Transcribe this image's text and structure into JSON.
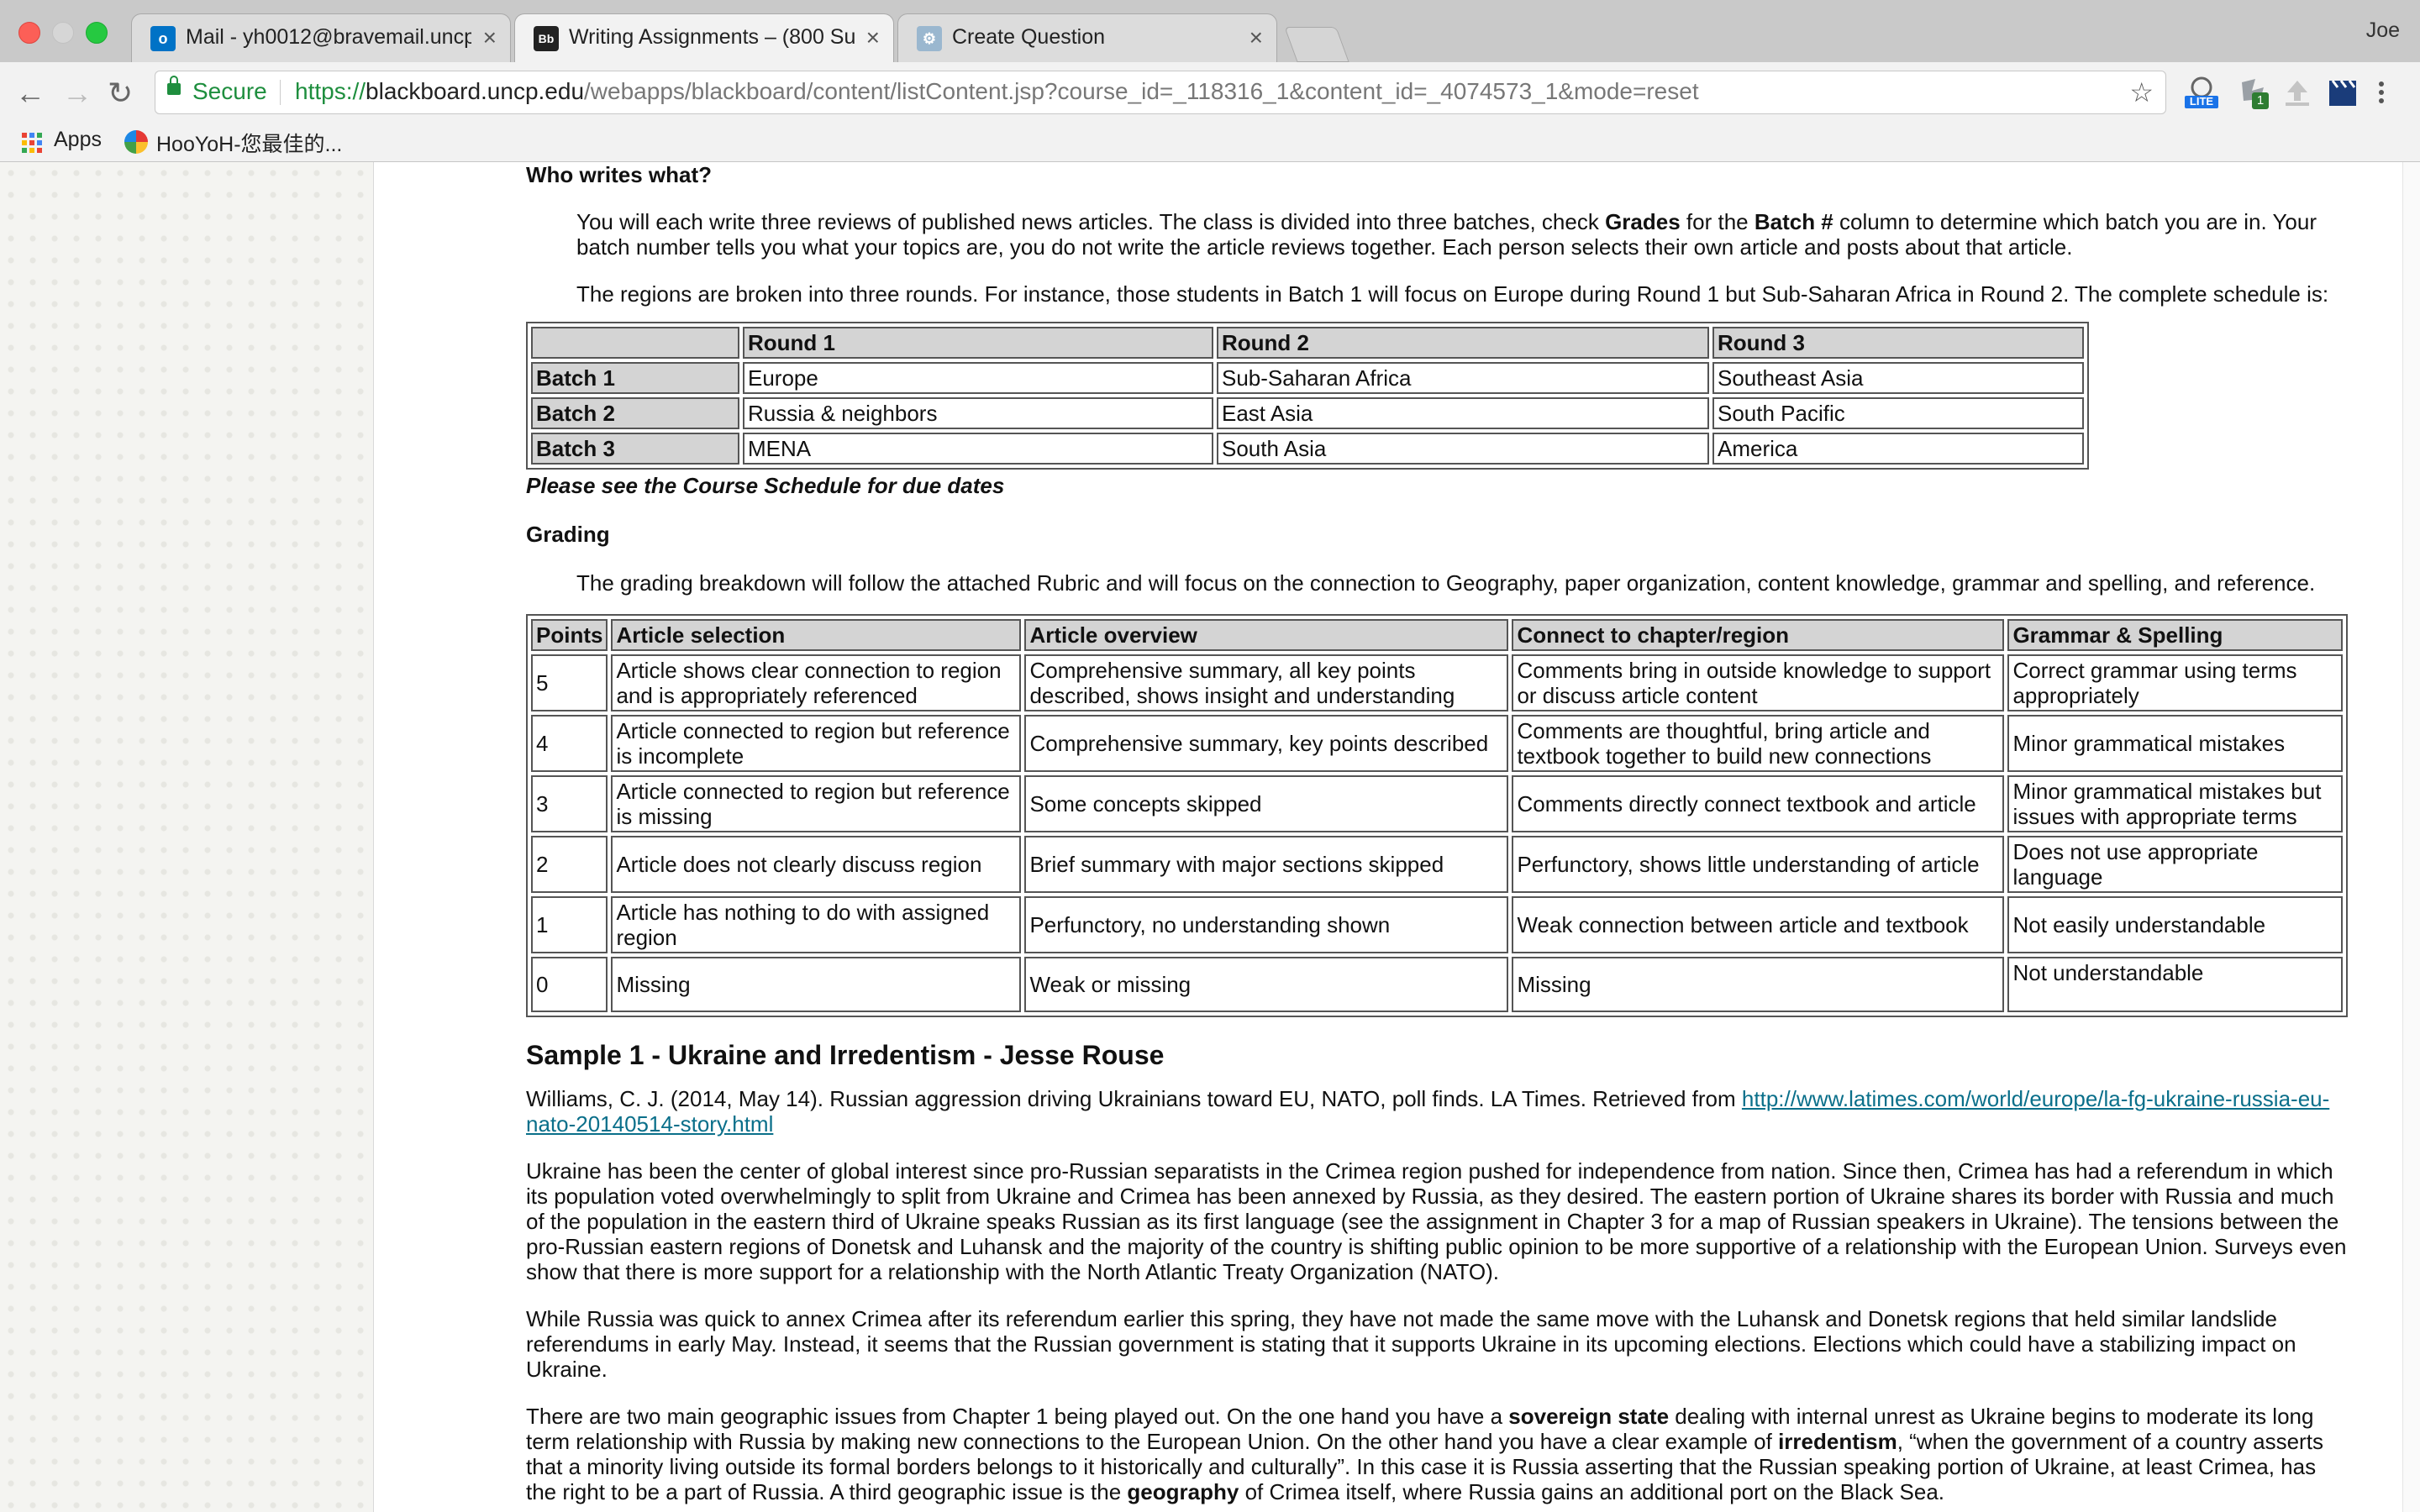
{
  "browser": {
    "tabs": [
      {
        "title": "Mail - yh0012@bravemail.uncp",
        "favicon": "outlook-icon"
      },
      {
        "title": "Writing Assignments – (800 Su",
        "favicon": "blackboard-icon"
      },
      {
        "title": "Create Question",
        "favicon": "gear-tab-icon"
      }
    ],
    "profile": "Joe",
    "secure_label": "Secure",
    "url": {
      "protocol": "https://",
      "host": "blackboard.uncp.edu",
      "path": "/webapps/blackboard/content/listContent.jsp?course_id=_118316_1&content_id=_4074573_1&mode=reset"
    },
    "bookmarks": [
      {
        "label": "Apps"
      },
      {
        "label": "HooYoH-您最佳的..."
      }
    ],
    "extensions": {
      "lite_label": "LITE",
      "badge_count": "1"
    }
  },
  "content": {
    "who_heading": "Who writes what?",
    "who_para1": {
      "part1": "You will each write three reviews of published news articles. The class is divided into three batches, check ",
      "bold1": "Grades",
      "part2": " for the ",
      "bold2": "Batch #",
      "part3": " column to determine which batch you are in. Your batch number tells you what your topics are, you do not write the article reviews together. Each person selects their own article and posts about that article."
    },
    "who_para2": "The regions are broken into three rounds. For instance, those students in Batch 1 will focus on Europe during Round 1 but Sub-Saharan Africa in Round 2. The complete schedule is:",
    "schedule": {
      "headers": [
        "",
        "Round 1",
        "Round 2",
        "Round 3"
      ],
      "rows": [
        [
          "Batch 1",
          "Europe",
          "Sub-Saharan Africa",
          "Southeast Asia"
        ],
        [
          "Batch 2",
          "Russia & neighbors",
          "East Asia",
          "South Pacific"
        ],
        [
          "Batch 3",
          "MENA",
          "South Asia",
          "America"
        ]
      ]
    },
    "schedule_note": "Please see the Course Schedule for due dates",
    "grading_heading": "Grading",
    "grading_para": "The grading breakdown will follow the attached Rubric and will focus on the connection to Geography, paper organization, content knowledge, grammar and spelling, and reference.",
    "rubric": {
      "headers": [
        "Points",
        "Article selection",
        "Article overview",
        "Connect to chapter/region",
        "Grammar & Spelling"
      ],
      "rows": [
        [
          "5",
          "Article shows clear connection to region and is appropriately referenced",
          "Comprehensive summary, all key points described, shows insight and understanding",
          "Comments bring in outside knowledge to support or discuss article content",
          "Correct grammar using terms appropriately"
        ],
        [
          "4",
          "Article connected to region but reference is incomplete",
          "Comprehensive summary, key points described",
          "Comments are thoughtful, bring article and textbook together to build new connections",
          "Minor grammatical mistakes"
        ],
        [
          "3",
          "Article connected to region but reference is missing",
          "Some concepts skipped",
          "Comments directly connect textbook and article",
          "Minor grammatical mistakes but issues with appropriate terms"
        ],
        [
          "2",
          "Article does not clearly discuss region",
          "Brief summary with major sections skipped",
          "Perfunctory, shows little understanding of article",
          "Does not use appropriate language"
        ],
        [
          "1",
          "Article has nothing to do with assigned region",
          "Perfunctory, no understanding shown",
          "Weak connection between article and textbook",
          "Not easily understandable"
        ],
        [
          "0",
          "Missing",
          "Weak or missing",
          "Missing",
          "Not understandable"
        ]
      ]
    },
    "sample_heading": "Sample 1 - Ukraine and Irredentism - Jesse Rouse",
    "citation_text": "Williams, C. J. (2014, May 14). Russian aggression driving Ukrainians toward EU, NATO, poll finds. LA Times. Retrieved from ",
    "citation_link": "http://www.latimes.com/world/europe/la-fg-ukraine-russia-eu-nato-20140514-story.html",
    "body_para1": "Ukraine has been the center of global interest since pro-Russian separatists in the Crimea region pushed for independence from nation. Since then, Crimea has had a referendum in which its population voted overwhelmingly to split from Ukraine and Crimea has been annexed by Russia, as they desired. The eastern portion of Ukraine shares its border with Russia and much of the population in the eastern third of Ukraine speaks Russian as its first language (see the assignment in Chapter 3 for a map of Russian speakers in Ukraine). The tensions between the pro-Russian eastern regions of Donetsk and Luhansk and the majority of the country is shifting public opinion to be more supportive of a relationship with the European Union. Surveys even show that there is more support for a relationship with the North Atlantic Treaty Organization (NATO).",
    "body_para2": "While Russia was quick to annex Crimea after its referendum earlier this spring, they have not made the same move with the Luhansk and Donetsk regions that held similar landslide referendums in early May. Instead, it seems that the Russian government is stating that it supports Ukraine in its upcoming elections. Elections which could have a stabilizing impact on Ukraine.",
    "body_para3": {
      "part1": "There are two main geographic issues from Chapter 1 being played out. On the one hand you have a ",
      "bold1": "sovereign state",
      "part2": " dealing with internal unrest as Ukraine begins to moderate its long term relationship with Russia by making new connections to the European Union. On the other hand you have a clear example of ",
      "bold2": "irredentism",
      "part3": ", “when the government of a country asserts that a minority living outside its formal borders belongs to it historically and culturally”. In this case it is Russia asserting that the Russian speaking portion of Ukraine, at least Crimea, has the right to be a part of Russia. A third geographic issue is the ",
      "bold3": "geography",
      "part4": " of Crimea itself, where Russia gains an additional port on the Black Sea."
    }
  }
}
